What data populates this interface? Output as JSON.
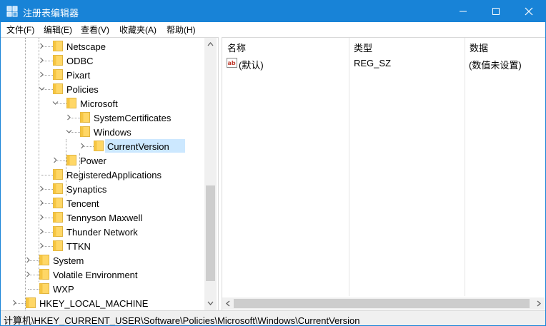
{
  "window": {
    "title": "注册表编辑器"
  },
  "menu": [
    "文件(F)",
    "编辑(E)",
    "查看(V)",
    "收藏夹(A)",
    "帮助(H)"
  ],
  "tree": [
    {
      "label": "Netscape",
      "level": 3,
      "state": "collapsed"
    },
    {
      "label": "ODBC",
      "level": 3,
      "state": "collapsed"
    },
    {
      "label": "Pixart",
      "level": 3,
      "state": "collapsed"
    },
    {
      "label": "Policies",
      "level": 3,
      "state": "expanded"
    },
    {
      "label": "Microsoft",
      "level": 4,
      "state": "expanded"
    },
    {
      "label": "SystemCertificates",
      "level": 5,
      "state": "collapsed"
    },
    {
      "label": "Windows",
      "level": 5,
      "state": "expanded"
    },
    {
      "label": "CurrentVersion",
      "level": 6,
      "state": "collapsed",
      "selected": true
    },
    {
      "label": "Power",
      "level": 4,
      "state": "collapsed"
    },
    {
      "label": "RegisteredApplications",
      "level": 3,
      "state": "leaf"
    },
    {
      "label": "Synaptics",
      "level": 3,
      "state": "collapsed"
    },
    {
      "label": "Tencent",
      "level": 3,
      "state": "collapsed"
    },
    {
      "label": "Tennyson Maxwell",
      "level": 3,
      "state": "collapsed"
    },
    {
      "label": "Thunder Network",
      "level": 3,
      "state": "collapsed"
    },
    {
      "label": "TTKN",
      "level": 3,
      "state": "collapsed"
    },
    {
      "label": "System",
      "level": 2,
      "state": "collapsed"
    },
    {
      "label": "Volatile Environment",
      "level": 2,
      "state": "collapsed"
    },
    {
      "label": "WXP",
      "level": 2,
      "state": "leaf"
    },
    {
      "label": "HKEY_LOCAL_MACHINE",
      "level": 1,
      "state": "collapsed"
    }
  ],
  "columns": {
    "name": "名称",
    "type": "类型",
    "data": "数据"
  },
  "values": [
    {
      "name": "(默认)",
      "type": "REG_SZ",
      "data": "(数值未设置)"
    }
  ],
  "status": {
    "path": "计算机\\HKEY_CURRENT_USER\\Software\\Policies\\Microsoft\\Windows\\CurrentVersion"
  },
  "colors": {
    "title_bar": "#1883d7",
    "selection": "#cce8ff",
    "folder": "#ffd766"
  }
}
